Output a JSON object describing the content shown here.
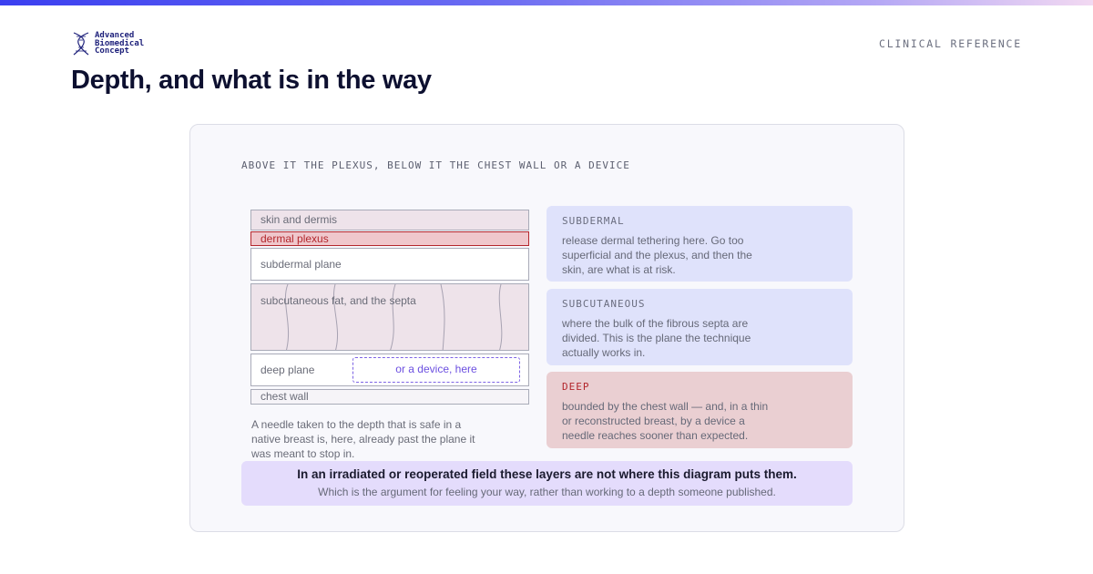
{
  "brand": {
    "logo_line1": "Advanced",
    "logo_line2": "Biomedical",
    "logo_line3": "Concept",
    "logo_icon": "dna-helix-icon"
  },
  "header": {
    "eyebrow": "CLINICAL REFERENCE",
    "title": "Depth, and what is in the way"
  },
  "diagram": {
    "caption": "ABOVE IT THE PLEXUS, BELOW IT THE CHEST WALL OR A DEVICE",
    "layers": {
      "skin": "skin and dermis",
      "plexus": "dermal plexus",
      "subdermal": "subdermal plane",
      "fat": "subcutaneous fat, and the septa",
      "deep": "deep plane",
      "chest": "chest wall"
    },
    "device_label": "or a device, here",
    "note": "A needle taken to the depth that is safe in a native breast is, here, already past the plane it was meant to stop in."
  },
  "planes": [
    {
      "heading": "SUBDERMAL",
      "body": "release dermal tethering here. Go too superficial and the plexus, and then the skin, are what is at risk."
    },
    {
      "heading": "SUBCUTANEOUS",
      "body": "where the bulk of the fibrous septa are divided. This is the plane the technique actually works in."
    },
    {
      "heading": "DEEP",
      "body": "bounded by the chest wall — and, in a thin or reconstructed breast, by a device a needle reaches sooner than expected."
    }
  ],
  "banner": {
    "main": "In an irradiated or reoperated field these layers are not where this diagram puts them.",
    "sub": "Which is the argument for feeling your way, rather than working to a depth someone published."
  },
  "colors": {
    "accent": "#3b3ff0",
    "plexus_red": "#b3272d",
    "device_purple": "#6b4fe0",
    "plane_blue": "#dfe2fb",
    "deep_pink": "#eacfd2",
    "banner_lilac": "#e4dcfc"
  }
}
